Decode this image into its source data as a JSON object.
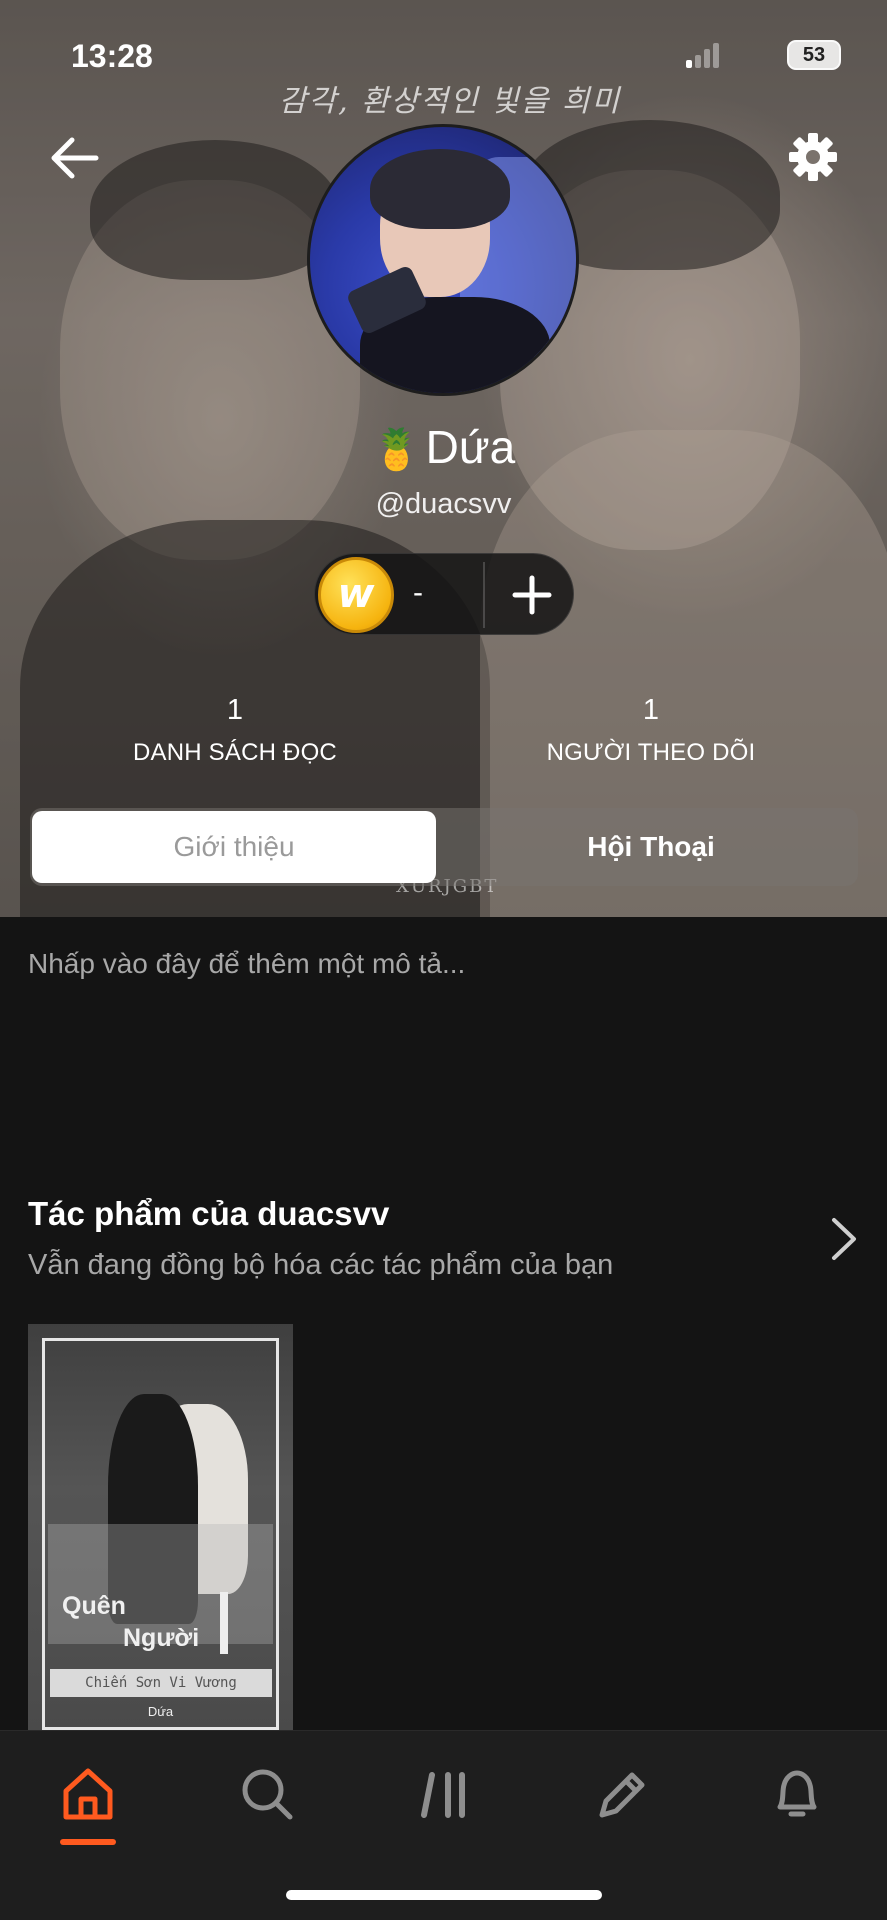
{
  "status_bar": {
    "time": "13:28",
    "battery": "53"
  },
  "cover": {
    "korean_text": "감각, 환상적인 빛을 희미",
    "watermark": "XURJGBT"
  },
  "profile": {
    "display_name": "Dứa",
    "pineapple_emoji": "🍍",
    "username": "@duacsvv",
    "coins_value": "-",
    "coin_icon_letter": "w"
  },
  "stats": [
    {
      "value": "1",
      "label": "DANH SÁCH ĐỌC"
    },
    {
      "value": "1",
      "label": "NGƯỜI THEO DÕI"
    }
  ],
  "tabs": [
    {
      "label": "Giới thiệu",
      "active": true
    },
    {
      "label": "Hội Thoại",
      "active": false
    }
  ],
  "about": {
    "placeholder": "Nhấp vào đây để thêm một mô tả..."
  },
  "works": {
    "title": "Tác phẩm của duacsvv",
    "subtitle": "Vẫn đang đồng bộ hóa các tác phẩm của bạn",
    "books": [
      {
        "title_line1": "Quên",
        "title_line2": "Người",
        "title_full": "Chiến Sơn Vi Vương",
        "author": "Dứa"
      }
    ]
  },
  "bottom_nav": {
    "items": [
      "home-icon",
      "search-icon",
      "library-icon",
      "write-icon",
      "bell-icon"
    ],
    "active_index": 0,
    "accent_color": "#ff5a1f"
  }
}
